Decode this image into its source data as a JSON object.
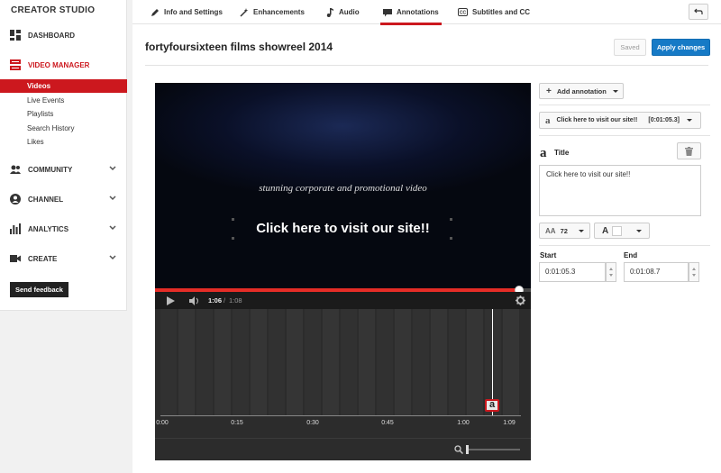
{
  "sidebar": {
    "brand": "CREATOR STUDIO",
    "dashboard": "DASHBOARD",
    "video_manager": "VIDEO MANAGER",
    "video_manager_items": [
      "Videos",
      "Live Events",
      "Playlists",
      "Search History",
      "Likes"
    ],
    "community": "COMMUNITY",
    "channel": "CHANNEL",
    "analytics": "ANALYTICS",
    "create": "CREATE",
    "feedback": "Send feedback"
  },
  "tabs": {
    "info": "Info and Settings",
    "enhancements": "Enhancements",
    "audio": "Audio",
    "annotations": "Annotations",
    "subtitles": "Subtitles and CC"
  },
  "video": {
    "title": "fortyfoursixteen films showreel 2014",
    "saved": "Saved",
    "apply": "Apply changes",
    "tagline": "stunning corporate and promotional video",
    "annotation_text": "Click here to visit our site!!",
    "current_time": "1:06",
    "duration": "1:08",
    "progress_fraction": 0.97
  },
  "timeline": {
    "ticks": [
      "0:00",
      "0:15",
      "0:30",
      "0:45",
      "1:00",
      "1:09"
    ],
    "playhead_fraction": 0.92,
    "annotation_marker": "a"
  },
  "panel": {
    "add_annotation": "Add annotation",
    "selected_annotation": "Click here to visit our site!!",
    "selected_time": "[0:01:05.3]",
    "type_label": "Title",
    "text_value": "Click here to visit our site!!",
    "font_size": "72",
    "start_label": "Start",
    "start_value": "0:01:05.3",
    "end_label": "End",
    "end_value": "0:01:08.7"
  },
  "colors": {
    "accent": "#cc181e",
    "primary_button": "#167ac6"
  }
}
